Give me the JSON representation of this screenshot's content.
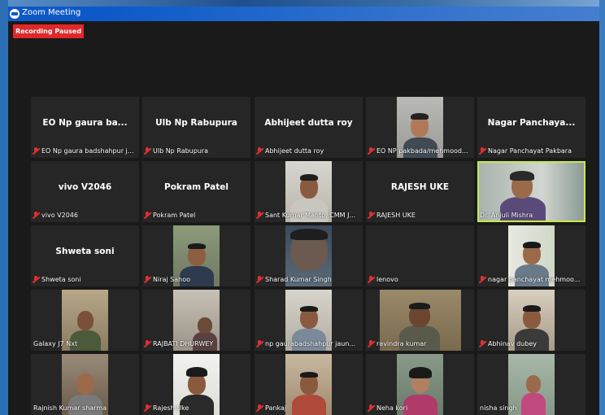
{
  "window": {
    "title": "Zoom Meeting"
  },
  "recording": {
    "label": "Recording Paused"
  },
  "participants": [
    {
      "big": "EO Np gaura ba...",
      "label": "EO Np gaura badshahpur j..."
    },
    {
      "big": "Ulb Np Rabupura",
      "label": "Ulb Np Rabupura"
    },
    {
      "big": "Abhijeet dutta roy",
      "label": "Abhijeet dutta roy"
    },
    {
      "big": "",
      "label": "EO NP pakbada/mehmood..."
    },
    {
      "big": "Nagar  Panchaya...",
      "label": "Nagar Panchayat Pakbara"
    },
    {
      "big": "vivo V2046",
      "label": "vivo V2046"
    },
    {
      "big": "Pokram Patel",
      "label": "Pokram Patel"
    },
    {
      "big": "",
      "label": "Sant Kumar Mahto, CMM J..."
    },
    {
      "big": "RAJESH UKE",
      "label": "RAJESH UKE"
    },
    {
      "big": "",
      "label": "Dr. Anjuli Mishra"
    },
    {
      "big": "Shweta soni",
      "label": "Shweta soni"
    },
    {
      "big": "",
      "label": "Niraj Sahoo"
    },
    {
      "big": "",
      "label": "Sharad Kumar Singh"
    },
    {
      "big": "",
      "label": "lenovo"
    },
    {
      "big": "",
      "label": "nagar panchayat mehmoo..."
    },
    {
      "big": "",
      "label": "Galaxy J7 Nxt"
    },
    {
      "big": "",
      "label": "RAJBATI DHURWEY"
    },
    {
      "big": "",
      "label": "np gaurabadshahpur jaun..."
    },
    {
      "big": "",
      "label": "ravindra kumar"
    },
    {
      "big": "",
      "label": "Abhinav dubey"
    },
    {
      "big": "",
      "label": "Rajnish Kumar sharma"
    },
    {
      "big": "",
      "label": "Rajesh Uke"
    },
    {
      "big": "",
      "label": "Pankaj"
    },
    {
      "big": "",
      "label": "Neha kori"
    },
    {
      "big": "",
      "label": "nisha singh"
    }
  ],
  "colors": {
    "active_speaker": "#c8e84b",
    "muted_icon": "#e03030",
    "recording_badge": "#e02828"
  }
}
